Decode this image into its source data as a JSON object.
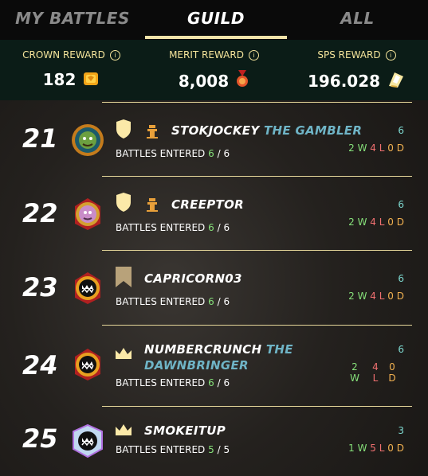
{
  "tabs": [
    {
      "label": "MY BATTLES",
      "active": false
    },
    {
      "label": "GUILD",
      "active": true
    },
    {
      "label": "ALL",
      "active": false
    }
  ],
  "rewards": {
    "crown": {
      "label": "CROWN REWARD",
      "value": "182",
      "icon": "crown-token-icon"
    },
    "merit": {
      "label": "MERIT REWARD",
      "value": "8,008",
      "icon": "merit-medal-icon"
    },
    "sps": {
      "label": "SPS REWARD",
      "value": "196.028",
      "icon": "sps-token-icon"
    }
  },
  "rows": [
    {
      "rank": "21",
      "name": "STOKJOCKEY",
      "title": "THE GAMBLER",
      "battles_label": "BATTLES ENTERED",
      "entered": "6",
      "total": "6",
      "count": "6",
      "wins": "2",
      "losses": "4",
      "draws": "0",
      "w": "W",
      "l": "L",
      "d": "D",
      "league_icon": "shield-icon",
      "guild_icon": "guild-tower-icon"
    },
    {
      "rank": "22",
      "name": "CREEPTOR",
      "title": "",
      "battles_label": "BATTLES ENTERED",
      "entered": "6",
      "total": "6",
      "count": "6",
      "wins": "2",
      "losses": "4",
      "draws": "0",
      "w": "W",
      "l": "L",
      "d": "D",
      "league_icon": "shield-icon",
      "guild_icon": "guild-tower-icon"
    },
    {
      "rank": "23",
      "name": "CAPRICORN03",
      "title": "",
      "battles_label": "BATTLES ENTERED",
      "entered": "6",
      "total": "6",
      "count": "6",
      "wins": "2",
      "losses": "4",
      "draws": "0",
      "w": "W",
      "l": "L",
      "d": "D",
      "league_icon": "banner-icon",
      "guild_icon": ""
    },
    {
      "rank": "24",
      "name": "NUMBERCRUNCH",
      "title": "THE",
      "title2": "DAWNBRINGER",
      "battles_label": "BATTLES ENTERED",
      "entered": "6",
      "total": "6",
      "count": "6",
      "wins": "2",
      "losses": "4",
      "draws": "0",
      "w": "W",
      "l": "L",
      "d": "D",
      "league_icon": "crown-icon",
      "guild_icon": ""
    },
    {
      "rank": "25",
      "name": "SMOKEITUP",
      "title": "",
      "battles_label": "BATTLES ENTERED",
      "entered": "5",
      "total": "5",
      "count": "3",
      "wins": "1",
      "losses": "5",
      "draws": "0",
      "w": "W",
      "l": "L",
      "d": "D",
      "league_icon": "crown-icon",
      "guild_icon": ""
    }
  ],
  "colors": {
    "accent": "#f0e2a8",
    "win": "#86e07a",
    "loss": "#f07070",
    "draw": "#f0b050",
    "title": "#6fb4c6",
    "count": "#7dd8cf"
  }
}
